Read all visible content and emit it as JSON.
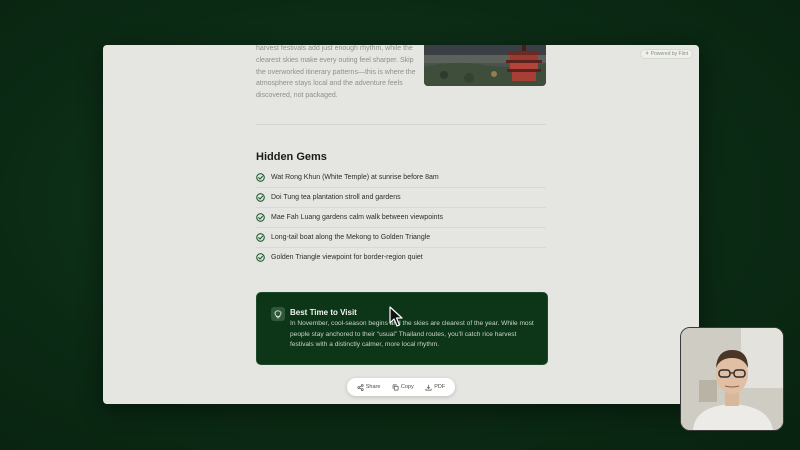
{
  "window": {
    "badge": "⚘ Powered by Flint",
    "intro_text": "harvest festivals add just enough rhythm, while the clearest skies make every outing feel sharper. Skip the overworked itinerary patterns—this is where the atmosphere stays local and the adventure feels discovered, not packaged."
  },
  "hidden_gems": {
    "title": "Hidden Gems",
    "items": [
      "Wat Rong Khun (White Temple) at sunrise before 8am",
      "Doi Tung tea plantation stroll and gardens",
      "Mae Fah Luang gardens calm walk between viewpoints",
      "Long-tail boat along the Mekong to Golden Triangle",
      "Golden Triangle viewpoint for border-region quiet"
    ]
  },
  "callout": {
    "title": "Best Time to Visit",
    "body": "In November, cool-season begins and the skies are clearest of the year. While most people stay anchored to their “usual” Thailand routes, you’ll catch rice harvest festivals with a distinctly calmer, more local rhythm."
  },
  "toolbar": {
    "share_label": "Share",
    "copy_label": "Copy",
    "pdf_label": "PDF"
  },
  "colors": {
    "accent_green": "#0d3517",
    "page_bg": "#e5e6e1",
    "desktop_bg": "#0b2a14"
  }
}
